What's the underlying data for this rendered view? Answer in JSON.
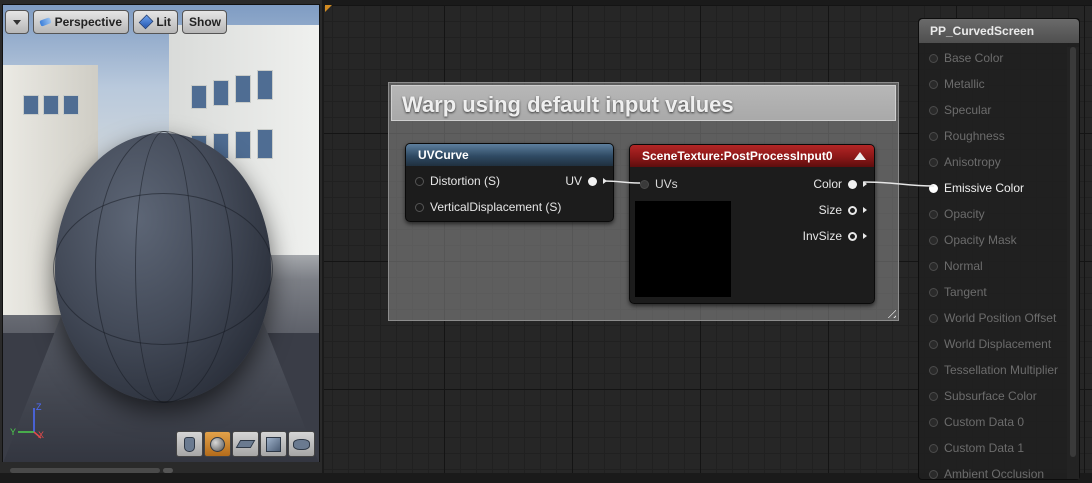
{
  "viewport": {
    "toolbar": {
      "menu_icon": "chevron-down-icon",
      "perspective_label": "Perspective",
      "lit_label": "Lit",
      "show_label": "Show"
    },
    "axis": {
      "x": "X",
      "y": "Y",
      "z": "Z"
    },
    "preview_shapes": [
      {
        "name": "preview-cylinder-button",
        "icon": "cylinder-icon",
        "active": false
      },
      {
        "name": "preview-sphere-button",
        "icon": "sphere-icon",
        "active": true
      },
      {
        "name": "preview-plane-button",
        "icon": "plane-icon",
        "active": false
      },
      {
        "name": "preview-cube-button",
        "icon": "cube-icon",
        "active": false
      },
      {
        "name": "preview-mesh-button",
        "icon": "teapot-icon",
        "active": false
      }
    ]
  },
  "comment": {
    "title": "Warp using default input values"
  },
  "uvcurve": {
    "title": "UVCurve",
    "header_color": "#2f4a63",
    "inputs": [
      "Distortion (S)",
      "VerticalDisplacement (S)"
    ],
    "output": "UV"
  },
  "scenetexture": {
    "title": "SceneTexture:PostProcessInput0",
    "header_color": "#8b1717",
    "input": "UVs",
    "outputs": [
      "Color",
      "Size",
      "InvSize"
    ]
  },
  "result": {
    "title": "PP_CurvedScreen",
    "pins": [
      "Base Color",
      "Metallic",
      "Specular",
      "Roughness",
      "Anisotropy",
      "Emissive Color",
      "Opacity",
      "Opacity Mask",
      "Normal",
      "Tangent",
      "World Position Offset",
      "World Displacement",
      "Tessellation Multiplier",
      "Subsurface Color",
      "Custom Data 0",
      "Custom Data 1",
      "Ambient Occlusion"
    ],
    "active_pin": "Emissive Color"
  }
}
